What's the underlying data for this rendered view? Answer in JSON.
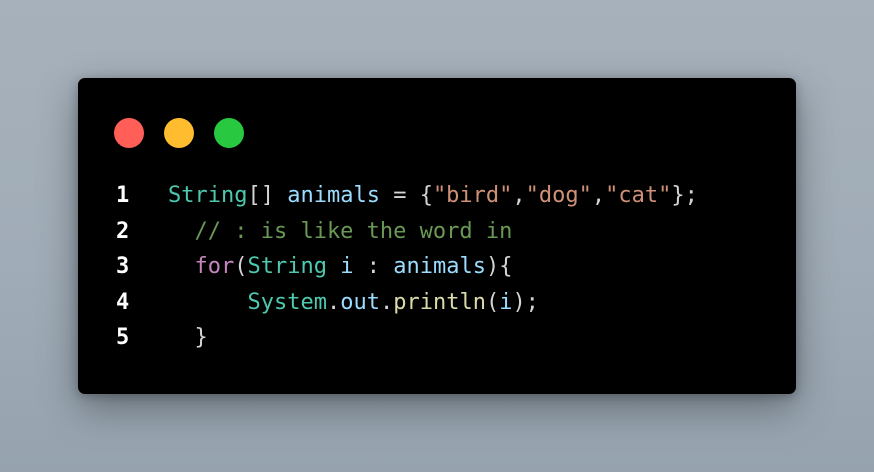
{
  "window": {
    "controls": [
      {
        "name": "close",
        "color": "#ff5f57"
      },
      {
        "name": "minimize",
        "color": "#febc2e"
      },
      {
        "name": "maximize",
        "color": "#28c840"
      }
    ]
  },
  "colors": {
    "type": "#4ec9b0",
    "variable": "#9cdcfe",
    "string": "#ce9178",
    "comment": "#6a9955",
    "keyword": "#c586c0",
    "function": "#dcdcaa",
    "punctuation": "#d4d4d4"
  },
  "code": {
    "lines": [
      {
        "number": "1",
        "tokens": [
          {
            "text": "String",
            "kind": "type"
          },
          {
            "text": "[] ",
            "kind": "punc"
          },
          {
            "text": "animals",
            "kind": "var"
          },
          {
            "text": " = {",
            "kind": "punc"
          },
          {
            "text": "\"bird\"",
            "kind": "str"
          },
          {
            "text": ",",
            "kind": "punc"
          },
          {
            "text": "\"dog\"",
            "kind": "str"
          },
          {
            "text": ",",
            "kind": "punc"
          },
          {
            "text": "\"cat\"",
            "kind": "str"
          },
          {
            "text": "};",
            "kind": "punc"
          }
        ]
      },
      {
        "number": "2",
        "tokens": [
          {
            "text": "  // : is like the word in",
            "kind": "cmt"
          }
        ]
      },
      {
        "number": "3",
        "tokens": [
          {
            "text": "  ",
            "kind": "punc"
          },
          {
            "text": "for",
            "kind": "kw"
          },
          {
            "text": "(",
            "kind": "punc"
          },
          {
            "text": "String",
            "kind": "type"
          },
          {
            "text": " ",
            "kind": "punc"
          },
          {
            "text": "i",
            "kind": "var"
          },
          {
            "text": " : ",
            "kind": "punc"
          },
          {
            "text": "animals",
            "kind": "var"
          },
          {
            "text": "){",
            "kind": "punc"
          }
        ]
      },
      {
        "number": "4",
        "tokens": [
          {
            "text": "      ",
            "kind": "punc"
          },
          {
            "text": "System",
            "kind": "type"
          },
          {
            "text": ".",
            "kind": "punc"
          },
          {
            "text": "out",
            "kind": "var"
          },
          {
            "text": ".",
            "kind": "punc"
          },
          {
            "text": "println",
            "kind": "fn"
          },
          {
            "text": "(",
            "kind": "punc"
          },
          {
            "text": "i",
            "kind": "var"
          },
          {
            "text": ");",
            "kind": "punc"
          }
        ]
      },
      {
        "number": "5",
        "tokens": [
          {
            "text": "  }",
            "kind": "punc"
          }
        ]
      }
    ]
  }
}
